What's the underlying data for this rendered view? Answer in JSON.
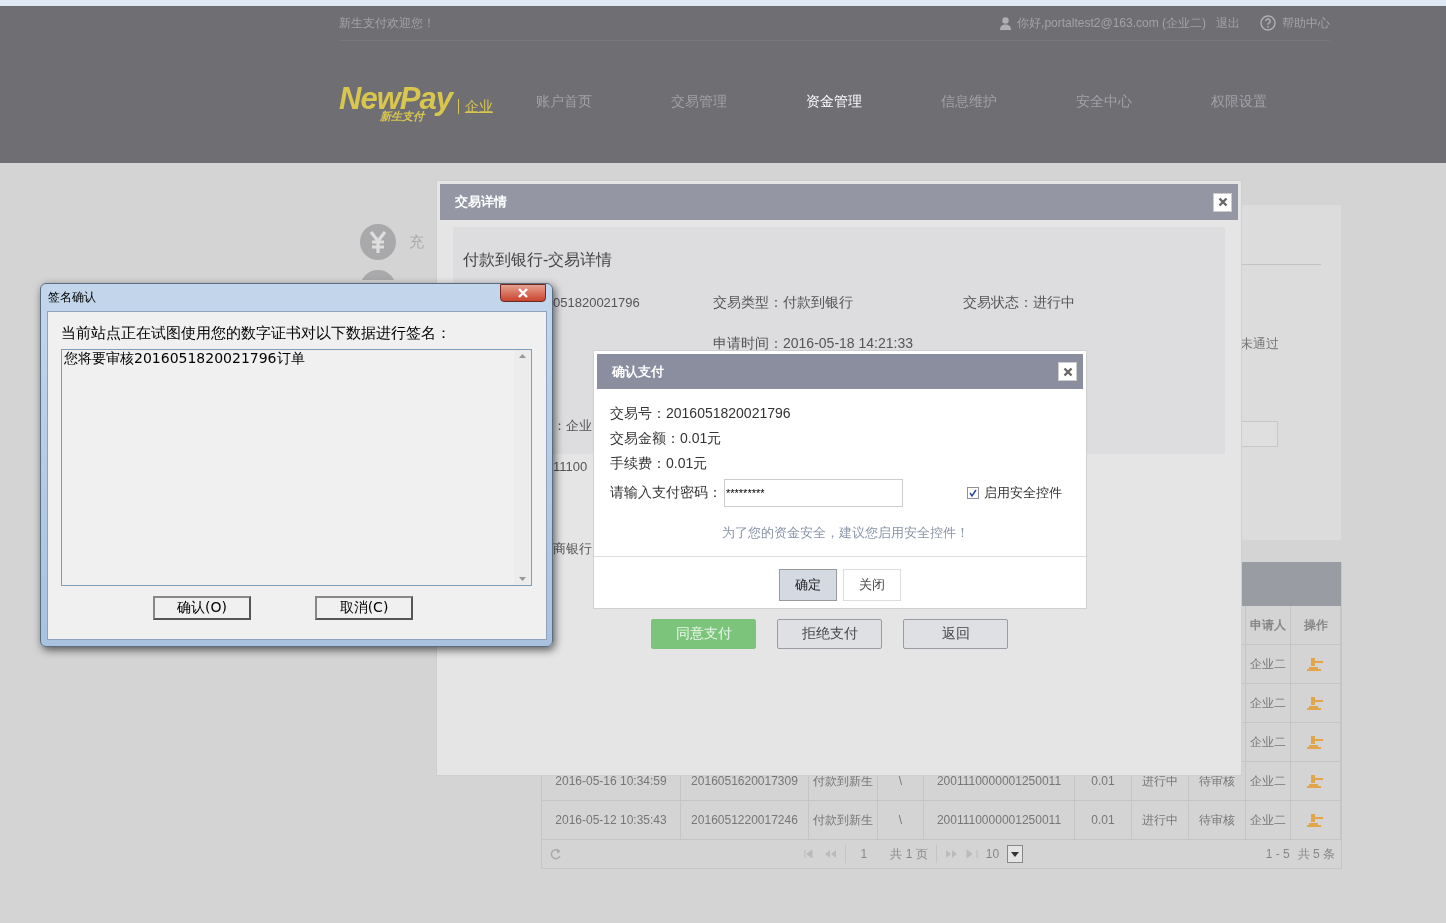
{
  "header": {
    "welcome": "新生支付欢迎您！",
    "user": "你好,portaltest2@163.com (企业二)",
    "logout": "退出",
    "help": "帮助中心",
    "logo": "NewPay",
    "logo_sub": "新生支付",
    "org": "企业",
    "nav": [
      {
        "label": "账户首页",
        "selected": false
      },
      {
        "label": "交易管理",
        "selected": false
      },
      {
        "label": "资金管理",
        "selected": true
      },
      {
        "label": "信息维护",
        "selected": false
      },
      {
        "label": "安全中心",
        "selected": false
      },
      {
        "label": "权限设置",
        "selected": false
      }
    ]
  },
  "sidebar": {
    "items": [
      {
        "kind": "yuan",
        "label": "充"
      },
      {
        "kind": "other"
      }
    ]
  },
  "side_panel": {
    "status": "未通过"
  },
  "table": {
    "header": {
      "applicant": "申请人",
      "action": "操作"
    },
    "rows": [
      {
        "applicant": "企业二"
      },
      {
        "applicant": "企业二"
      },
      {
        "applicant": "企业二"
      },
      {
        "column_1": "2016-05-16 10:34:59",
        "column_2": "2016051620017309",
        "column_3": "付款到新生",
        "column_4": "\\",
        "column_5": "2001110000001250011",
        "column_6": "0.01",
        "column_7": "进行中",
        "column_8": "待审核",
        "applicant": "企业二"
      },
      {
        "column_1": "2016-05-12 10:35:43",
        "column_2": "2016051220017246",
        "column_3": "付款到新生",
        "column_4": "\\",
        "column_5": "2001110000001250011",
        "column_6": "0.01",
        "column_7": "进行中",
        "column_8": "待审核",
        "applicant": "企业二"
      }
    ],
    "pager": {
      "page": "1",
      "pages": "共 1 页",
      "page_size": "10",
      "range": "1 - 5",
      "total": "共 5 条"
    }
  },
  "detail_dialog": {
    "title": "交易详情",
    "heading": "付款到银行-交易详情",
    "rows": [
      {
        "column_1": "051820021796",
        "column_2": "交易类型：付款到银行",
        "column_3": "交易状态：进行中"
      },
      {
        "column_2": "申请时间：2016-05-18 14:21:33"
      },
      {
        "column_1": "：企业"
      },
      {
        "column_1": "11100"
      },
      {
        "column_1": "商银行"
      }
    ],
    "buttons": [
      {
        "label": "同意支付",
        "kind": "success"
      },
      {
        "label": "拒绝支付",
        "kind": "default"
      },
      {
        "label": "返回",
        "kind": "default"
      }
    ]
  },
  "confirm_dialog": {
    "title": "确认支付",
    "lines": [
      "交易号：2016051820021796",
      "交易金额：0.01元",
      "手续费：0.01元"
    ],
    "password": {
      "label": "请输入支付密码：",
      "value": "*********"
    },
    "secure": {
      "label": "启用安全控件",
      "checked": true
    },
    "hint": "为了您的资金安全，建议您启用安全控件！",
    "buttons": [
      {
        "label": "确定",
        "kind": "primary"
      },
      {
        "label": "关闭",
        "kind": "default"
      }
    ]
  },
  "sign_dialog": {
    "title": "签名确认",
    "prompt": "当前站点正在试图使用您的数字证书对以下数据进行签名：",
    "content": "您将要审核2016051820021796订单",
    "buttons": [
      "确认(O)",
      "取消(C)"
    ]
  }
}
